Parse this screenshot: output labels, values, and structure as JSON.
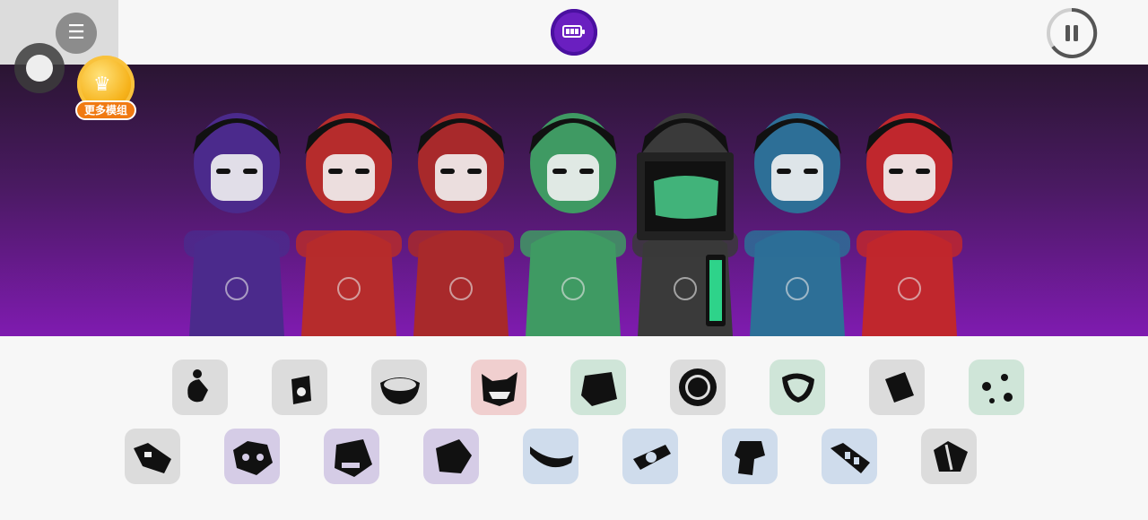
{
  "header": {
    "menu_icon": "hamburger-menu-icon",
    "battery_icon": "battery-icon",
    "pause_icon": "pause-icon",
    "vip": {
      "crown_glyph": "♛",
      "label": "更多模组"
    }
  },
  "menu_glyph": "☰",
  "characters": [
    {
      "name": "purple-horned-beast",
      "color": "#4b2a8c"
    },
    {
      "name": "red-visor-girl",
      "color": "#b62c2c"
    },
    {
      "name": "red-hooded-ninja",
      "color": "#a8292b"
    },
    {
      "name": "green-mask-character",
      "color": "#3f9a63"
    },
    {
      "name": "monitor-head-character",
      "color": "#3a3a3a"
    },
    {
      "name": "blue-helmet-character",
      "color": "#2d6f97"
    },
    {
      "name": "red-robot-character",
      "color": "#c0272d"
    }
  ],
  "palette": {
    "row1": [
      {
        "name": "gray-hook-sound",
        "bg": "#dcdcdc"
      },
      {
        "name": "gray-pill-sound",
        "bg": "#dcdcdc"
      },
      {
        "name": "gray-bowl-sound",
        "bg": "#dcdcdc"
      },
      {
        "name": "red-monster-sound",
        "bg": "#f0cfcf"
      },
      {
        "name": "green-cloth-sound",
        "bg": "#cfe5d8"
      },
      {
        "name": "gray-gear-sound",
        "bg": "#dcdcdc"
      },
      {
        "name": "green-leaf-sound",
        "bg": "#cfe5d8"
      },
      {
        "name": "gray-diamond-sound",
        "bg": "#dcdcdc"
      },
      {
        "name": "green-scatter-sound",
        "bg": "#cfe5d8"
      }
    ],
    "row2": [
      {
        "name": "gray-bolt-sound",
        "bg": "#dcdcdc"
      },
      {
        "name": "purple-mask-sound",
        "bg": "#d5cce6"
      },
      {
        "name": "purple-skull-sound",
        "bg": "#d5cce6"
      },
      {
        "name": "purple-blob-sound",
        "bg": "#d5cce6"
      },
      {
        "name": "blue-band-sound",
        "bg": "#cfdcec"
      },
      {
        "name": "blue-eye-sound",
        "bg": "#cfdcec"
      },
      {
        "name": "blue-helmet-sound",
        "bg": "#cfdcec"
      },
      {
        "name": "blue-stripes-sound",
        "bg": "#cfdcec"
      },
      {
        "name": "gray-shard-sound",
        "bg": "#dcdcdc"
      }
    ]
  }
}
